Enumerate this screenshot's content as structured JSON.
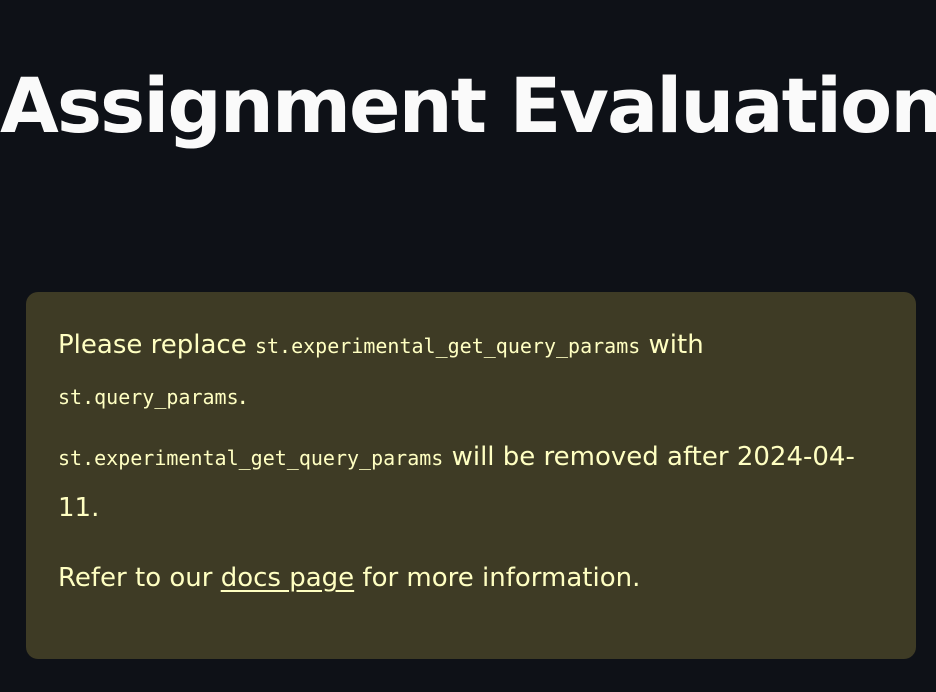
{
  "page": {
    "title": "Assignment Evaluation"
  },
  "warning": {
    "line1_prefix": "Please replace ",
    "deprecated_api": "st.experimental_get_query_params",
    "line1_middle": " with ",
    "new_api": "st.query_params",
    "line1_suffix": ".",
    "line2_api": "st.experimental_get_query_params",
    "line2_text": " will be removed after 2024-04-11.",
    "line3_prefix": "Refer to our ",
    "docs_link": "docs page",
    "line3_suffix": " for more information."
  },
  "colors": {
    "background": "#0e1117",
    "warning_background": "#3e3b25",
    "warning_text": "#ffffc2",
    "title_text": "#fafafa"
  }
}
